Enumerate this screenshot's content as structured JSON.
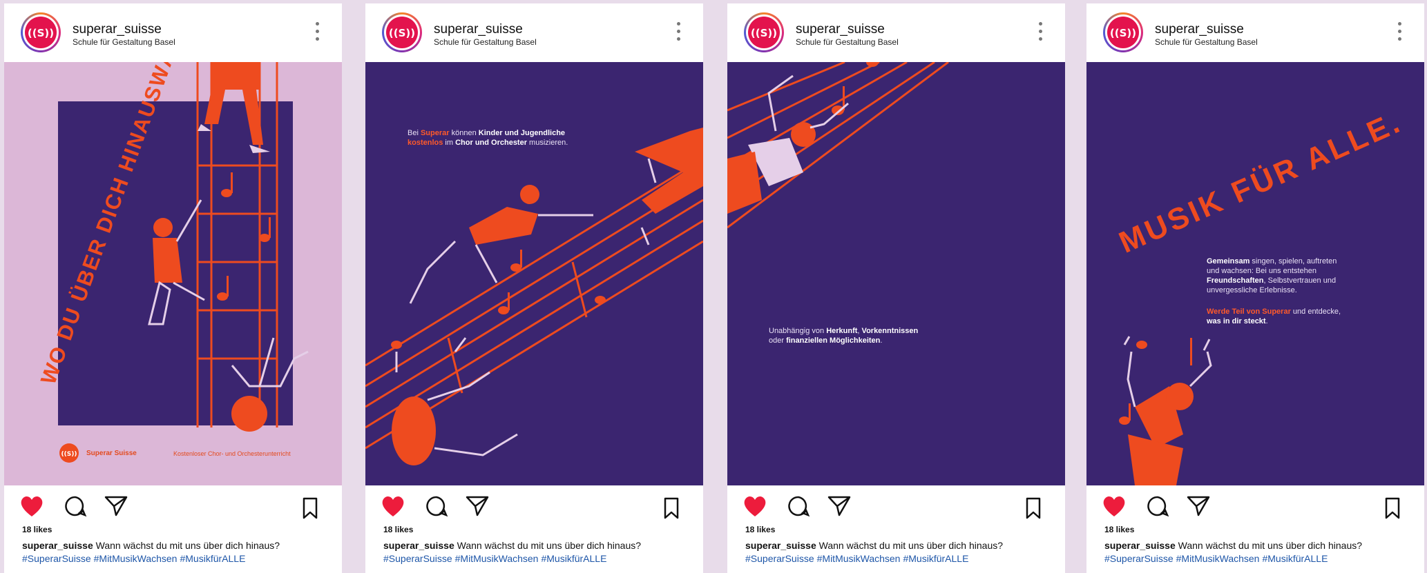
{
  "colors": {
    "purple": "#3b2570",
    "orange": "#ee4b1f",
    "pink_bg": "#dcb7d7",
    "lilac": "#e5cfe8",
    "like_red": "#ed1c3c",
    "hashtag_blue": "#1e56a8"
  },
  "icons": [
    "superar-logo-icon",
    "more-options-icon",
    "heart-icon",
    "comment-icon",
    "share-icon",
    "bookmark-icon"
  ],
  "posts": [
    {
      "username": "superar_suisse",
      "location": "Schule für Gestaltung Basel",
      "poster": {
        "headline": "WO DU ÜBER DICH HINAUSWÄCHST.",
        "brand": "Superar Suisse",
        "tagline": "Kostenloser Chor- und Orchesterunterricht"
      },
      "likes": "18 likes",
      "caption_user": "superar_suisse",
      "caption_text": "Wann wächst du mit uns über dich hinaus?",
      "hashtags": [
        "#SuperarSuisse",
        "#MitMusikWachsen",
        "#MusikfürALLE"
      ]
    },
    {
      "username": "superar_suisse",
      "location": "Schule für Gestaltung Basel",
      "poster": {
        "t1": "Bei ",
        "t2": "Superar",
        "t3": " können ",
        "t4": "Kinder und Jugendliche",
        "t5": "kostenlos",
        "t6": " im ",
        "t7": "Chor und Orchester",
        "t8": " musizieren."
      },
      "likes": "18 likes",
      "caption_user": "superar_suisse",
      "caption_text": "Wann wächst du mit uns über dich hinaus?",
      "hashtags": [
        "#SuperarSuisse",
        "#MitMusikWachsen",
        "#MusikfürALLE"
      ]
    },
    {
      "username": "superar_suisse",
      "location": "Schule für Gestaltung Basel",
      "poster": {
        "t1": "Unabhängig von ",
        "t2": "Herkunft",
        "t3": ", ",
        "t4": "Vorkenntnissen",
        "t5": "oder ",
        "t6": "finanziellen Möglichkeiten",
        "t7": "."
      },
      "likes": "18 likes",
      "caption_user": "superar_suisse",
      "caption_text": "Wann wächst du mit uns über dich hinaus?",
      "hashtags": [
        "#SuperarSuisse",
        "#MitMusikWachsen",
        "#MusikfürALLE"
      ]
    },
    {
      "username": "superar_suisse",
      "location": "Schule für Gestaltung Basel",
      "poster": {
        "headline": "MUSIK FÜR ALLE.",
        "p1a": "Gemeinsam",
        "p1b": " singen, spielen, auftreten",
        "p1c": "und wachsen: Bei uns entstehen",
        "p1d": "Freundschaften",
        "p1e": ", Selbstvertrauen und",
        "p1f": "unvergessliche Erlebnisse.",
        "p2a": "Werde Teil von Superar",
        "p2b": " und entdecke,",
        "p2c": "was in dir steckt",
        "p2d": "."
      },
      "likes": "18 likes",
      "caption_user": "superar_suisse",
      "caption_text": "Wann wächst du mit uns über dich hinaus?",
      "hashtags": [
        "#SuperarSuisse",
        "#MitMusikWachsen",
        "#MusikfürALLE"
      ]
    }
  ]
}
